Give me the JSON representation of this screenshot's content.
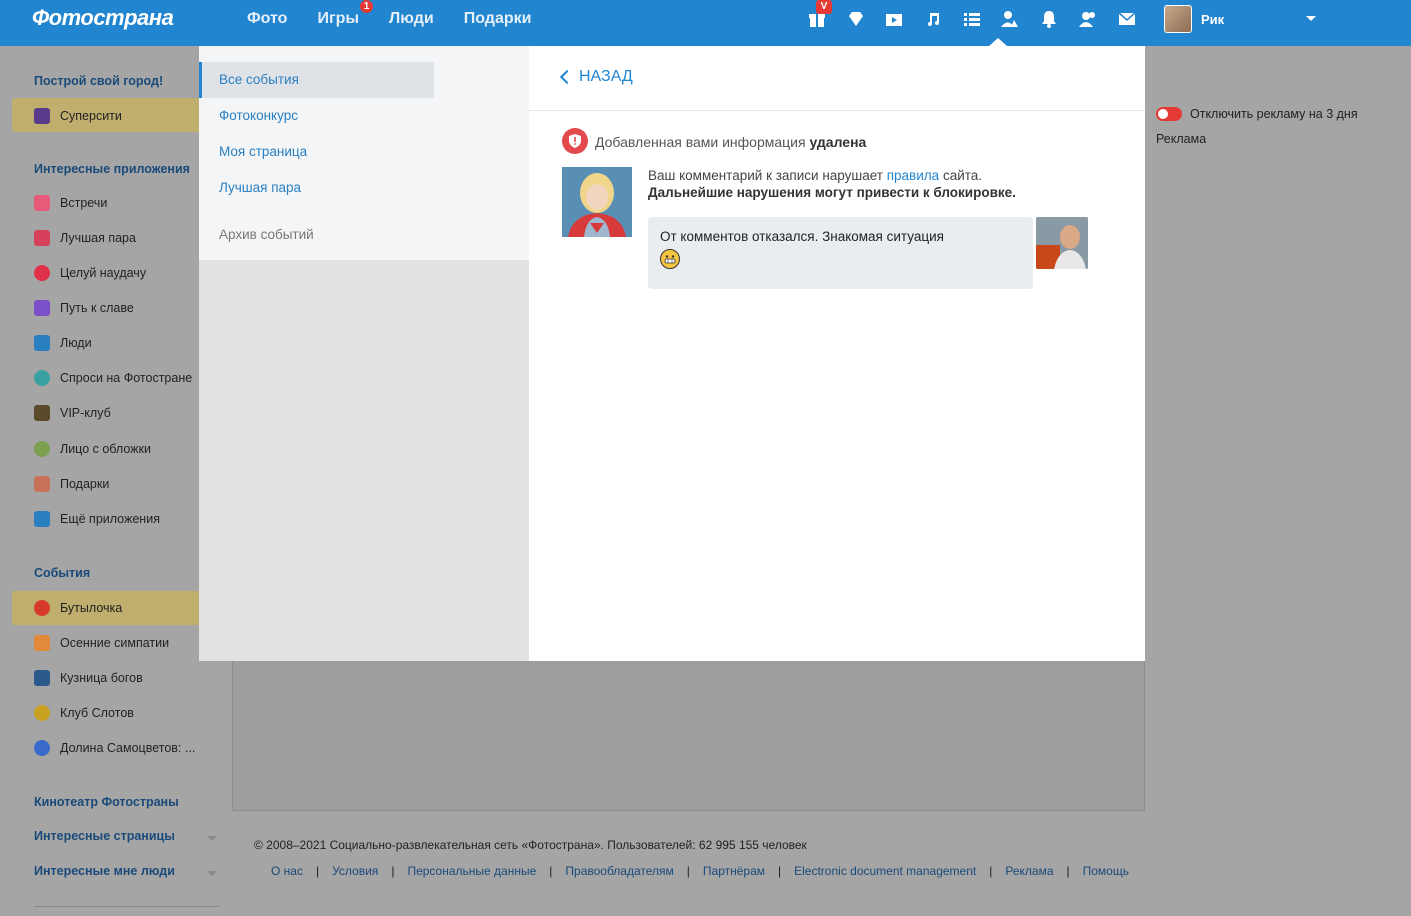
{
  "app": {
    "logo": "Фотострана"
  },
  "topnav": {
    "items": [
      {
        "label": "Фото"
      },
      {
        "label": "Игры",
        "badge": "1"
      },
      {
        "label": "Люди"
      },
      {
        "label": "Подарки"
      }
    ]
  },
  "topicons": {
    "vip_badge": "V",
    "icons": [
      "gift-icon",
      "diamond-icon",
      "video-icon",
      "music-icon",
      "list-icon",
      "person-alert-icon",
      "bell-icon",
      "friends-icon",
      "mail-icon"
    ]
  },
  "user": {
    "name": "Рик"
  },
  "sidebar": {
    "heading_city": "Построй свой город!",
    "supercity": "Суперсити",
    "heading_apps": "Интересные приложения",
    "apps": [
      {
        "label": "Встречи",
        "color": "#e85a7a"
      },
      {
        "label": "Лучшая пара",
        "color": "#d6405a"
      },
      {
        "label": "Целуй наудачу",
        "color": "#e0304a"
      },
      {
        "label": "Путь к славе",
        "color": "#7a4fc9"
      },
      {
        "label": "Люди",
        "color": "#2a7fc1"
      },
      {
        "label": "Спроси на Фотостране",
        "color": "#3aa0a0"
      },
      {
        "label": "VIP-клуб",
        "color": "#5a4a2a"
      },
      {
        "label": "Лицо с обложки",
        "color": "#7aa050"
      },
      {
        "label": "Подарки",
        "color": "#c9705a"
      },
      {
        "label": "Ещё приложения",
        "color": "#2a7fc1"
      }
    ],
    "heading_events": "События",
    "events": [
      {
        "label": "Бутылочка",
        "color": "#d63a2a"
      },
      {
        "label": "Осенние симпатии",
        "color": "#e08a3a"
      },
      {
        "label": "Кузница богов",
        "color": "#2a5a8a"
      },
      {
        "label": "Клуб Слотов",
        "color": "#c9a020"
      },
      {
        "label": "Долина Самоцветов: ...",
        "color": "#3a6ac9"
      }
    ],
    "heading_cinema": "Кинотеатр Фотостраны",
    "heading_pages": "Интересные страницы",
    "heading_people": "Интересные мне люди"
  },
  "popup_menu": {
    "items": [
      {
        "label": "Все события",
        "active": true
      },
      {
        "label": "Фотоконкурс"
      },
      {
        "label": "Моя страница"
      },
      {
        "label": "Лучшая пара"
      }
    ],
    "archive": "Архив событий"
  },
  "popup_content": {
    "back": "НАЗАД",
    "notice_prefix": "Добавленная вами информация",
    "notice_bold": "удалена",
    "msg1_prefix": "Ваш комментарий к записи нарушает",
    "msg1_link": "правила",
    "msg1_suffix": "сайта.",
    "msg2": "Дальнейшие нарушения могут привести к блокировке.",
    "comment": "От комментов отказался. Знакомая ситуация"
  },
  "ads": {
    "toggle_label": "Отключить рекламу на 3 дня",
    "ad_label": "Реклама"
  },
  "footer": {
    "copyright": "© 2008–2021 Социально-развлекательная сеть «Фотострана». Пользователей: 62 995 155 человек",
    "links": [
      "О нас",
      "Условия",
      "Персональные данные",
      "Правообладателям",
      "Партнёрам",
      "Electronic document management",
      "Реклама",
      "Помощь"
    ]
  }
}
